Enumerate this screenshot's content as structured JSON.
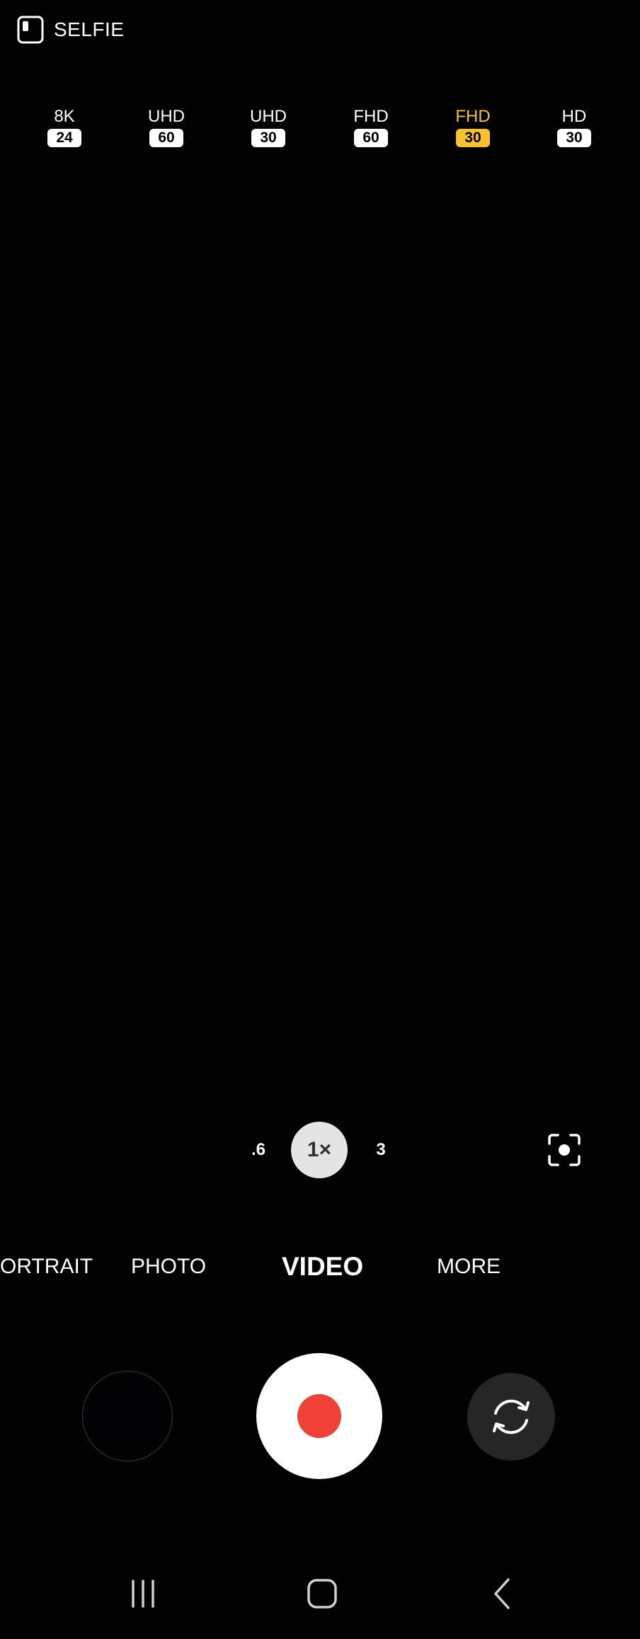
{
  "top": {
    "selfie_label": "SELFIE",
    "selfie_icon": "selfie-camera-icon"
  },
  "resolutions": [
    {
      "name": "8K",
      "fps": "24",
      "selected": false
    },
    {
      "name": "UHD",
      "fps": "60",
      "selected": false
    },
    {
      "name": "UHD",
      "fps": "30",
      "selected": false
    },
    {
      "name": "FHD",
      "fps": "60",
      "selected": false
    },
    {
      "name": "FHD",
      "fps": "30",
      "selected": true
    },
    {
      "name": "HD",
      "fps": "30",
      "selected": false
    }
  ],
  "zoom": {
    "wide": ".6",
    "current": "1×",
    "tele": "3",
    "focus_icon": "focus-target-icon"
  },
  "modes": {
    "portrait": "ORTRAIT",
    "photo": "PHOTO",
    "video": "VIDEO",
    "more": "MORE",
    "active": "VIDEO"
  },
  "controls": {
    "gallery_icon": "gallery-thumbnail",
    "record_icon": "record-icon",
    "switch_icon": "switch-camera-icon"
  },
  "nav": {
    "recents_icon": "recents-icon",
    "home_icon": "home-icon",
    "back_icon": "back-icon"
  },
  "colors": {
    "selected_accent": "#f6c32f",
    "record_red": "#ef4136",
    "background": "#020202"
  }
}
